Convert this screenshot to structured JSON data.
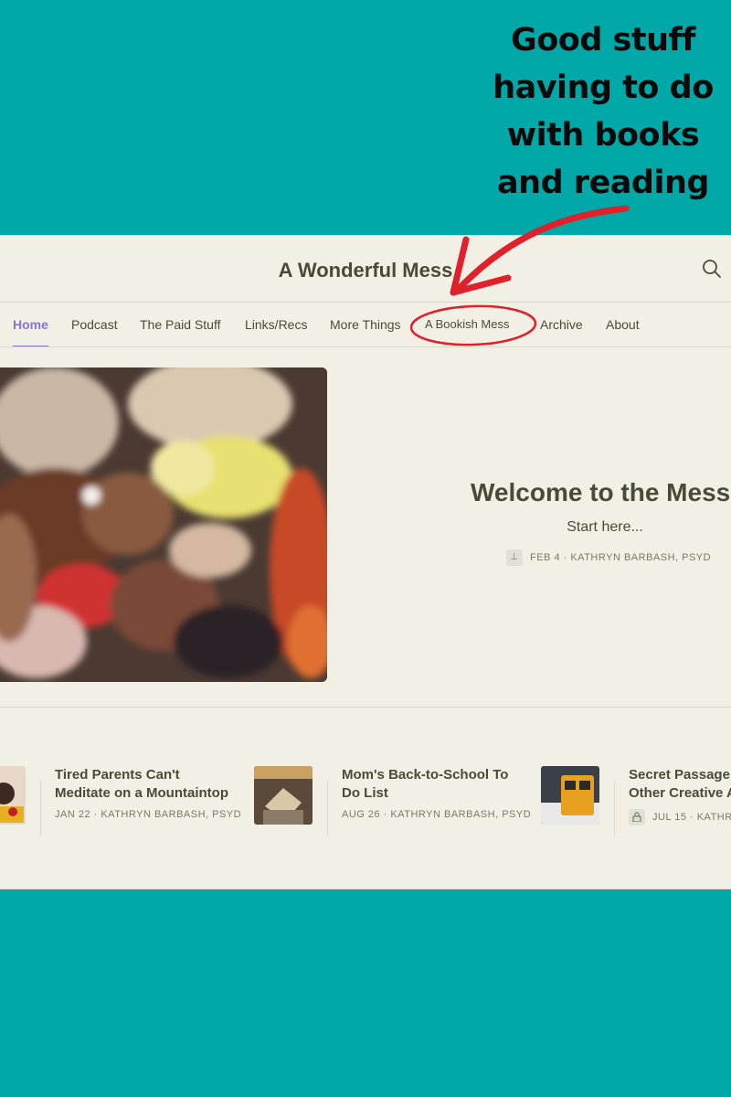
{
  "callout": {
    "lines": [
      "Good stuff",
      "having to do",
      "with books",
      "and reading"
    ]
  },
  "site": {
    "title": "A Wonderful Mess"
  },
  "nav": {
    "items": [
      {
        "label": "Home",
        "active": true
      },
      {
        "label": "Podcast",
        "active": false
      },
      {
        "label": "The Paid Stuff",
        "active": false
      },
      {
        "label": "Links/Recs",
        "active": false
      },
      {
        "label": "More Things",
        "active": false
      },
      {
        "label": "A Bookish Mess",
        "active": false
      },
      {
        "label": "Archive",
        "active": false
      },
      {
        "label": "About",
        "active": false
      }
    ]
  },
  "hero": {
    "title": "Welcome to the Mess",
    "subtitle": "Start here...",
    "meta": "FEB 4 · KATHRYN BARBASH, PSYD",
    "icon": "pin-icon"
  },
  "posts": [
    {
      "title_line1": "Tired Parents Can't",
      "title_line2": "Meditate on a Mountaintop",
      "meta": "JAN 22 · KATHRYN BARBASH, PSYD"
    },
    {
      "title_line1": "Mom's Back-to-School To",
      "title_line2": "Do List",
      "meta": "AUG 26 · KATHRYN BARBASH, PSYD"
    },
    {
      "title_line1": "Secret Passage",
      "title_line2": "Other Creative A",
      "meta": "JUL 15 · KATHR",
      "icon": "lock-icon"
    }
  ],
  "colors": {
    "background": "#00a8a8",
    "panel": "#f2f0e4",
    "accent": "#8a72d8",
    "annotation": "#e0202a"
  }
}
